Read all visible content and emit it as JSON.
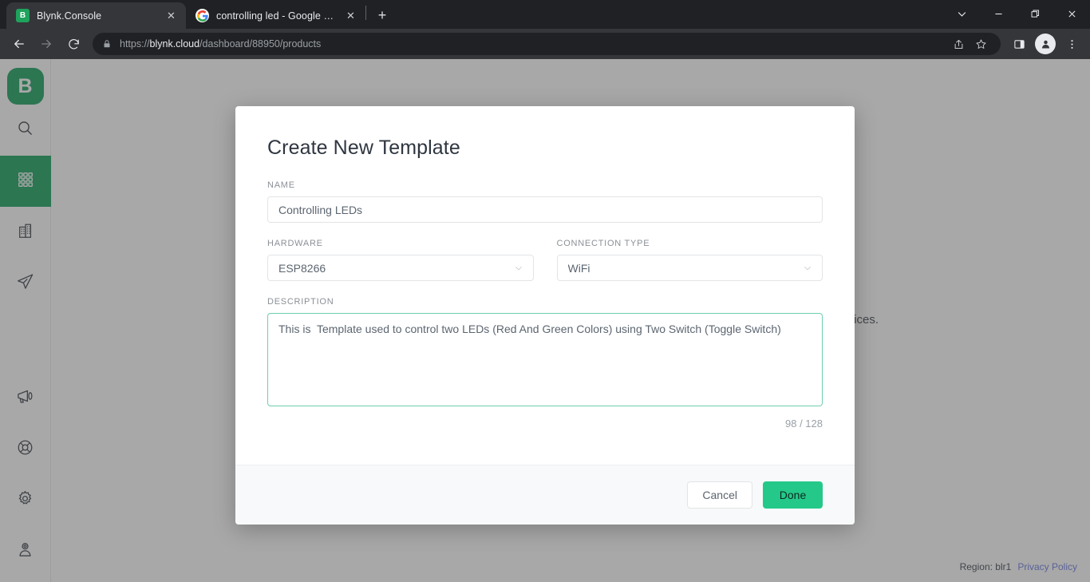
{
  "browser": {
    "tabs": [
      {
        "title": "Blynk.Console",
        "favicon": "blynk-icon",
        "active": true,
        "close_label": "✕"
      },
      {
        "title": "controlling led - Google Search",
        "favicon": "google-icon",
        "active": false,
        "close_label": "✕"
      }
    ],
    "new_tab_label": "+",
    "window_controls": {
      "tab_search": "tab-search-icon",
      "minimize": "minimize-icon",
      "maximize": "maximize-icon",
      "close": "close-icon"
    },
    "toolbar": {
      "back": "back-arrow-icon",
      "forward": "forward-arrow-icon",
      "reload": "reload-icon",
      "lock": "lock-icon",
      "url_prefix": "https://",
      "url_domain": "blynk.cloud",
      "url_path": "/dashboard/88950/products",
      "share": "share-icon",
      "bookmark": "star-icon",
      "side_panel": "side-panel-icon",
      "profile": "profile-avatar-icon",
      "menu": "three-dot-menu-icon"
    }
  },
  "sidebar": {
    "logo_letter": "B",
    "items": [
      {
        "name": "search",
        "icon": "search-icon",
        "active": false
      },
      {
        "name": "templates",
        "icon": "grid-apps-icon",
        "active": true
      },
      {
        "name": "organizations",
        "icon": "building-icon",
        "active": false
      },
      {
        "name": "send",
        "icon": "paper-plane-icon",
        "active": false
      },
      {
        "name": "announcements",
        "icon": "megaphone-icon",
        "active": false
      },
      {
        "name": "support",
        "icon": "lifebuoy-icon",
        "active": false
      },
      {
        "name": "settings",
        "icon": "gear-icon",
        "active": false
      },
      {
        "name": "account",
        "icon": "user-icon",
        "active": false
      }
    ]
  },
  "page": {
    "background_text": "devices.",
    "region_label": "Region: blr1",
    "privacy_policy": "Privacy Policy"
  },
  "modal": {
    "title": "Create New Template",
    "fields": {
      "name": {
        "label": "NAME",
        "value": "Controlling LEDs",
        "placeholder": ""
      },
      "hardware": {
        "label": "HARDWARE",
        "value": "ESP8266",
        "chevron": "chevron-down-icon"
      },
      "connection_type": {
        "label": "CONNECTION TYPE",
        "value": "WiFi",
        "chevron": "chevron-down-icon"
      },
      "description": {
        "label": "DESCRIPTION",
        "value": "This is  Template used to control two LEDs (Red And Green Colors) using Two Switch (Toggle Switch)",
        "counter": "98 / 128"
      }
    },
    "buttons": {
      "cancel": "Cancel",
      "done": "Done"
    }
  },
  "colors": {
    "brand_green": "#16a05d",
    "done_green": "#24c98a",
    "focus_border": "#6ecfae",
    "link_purple": "#6c7ae0",
    "chrome_dark": "#202124"
  }
}
